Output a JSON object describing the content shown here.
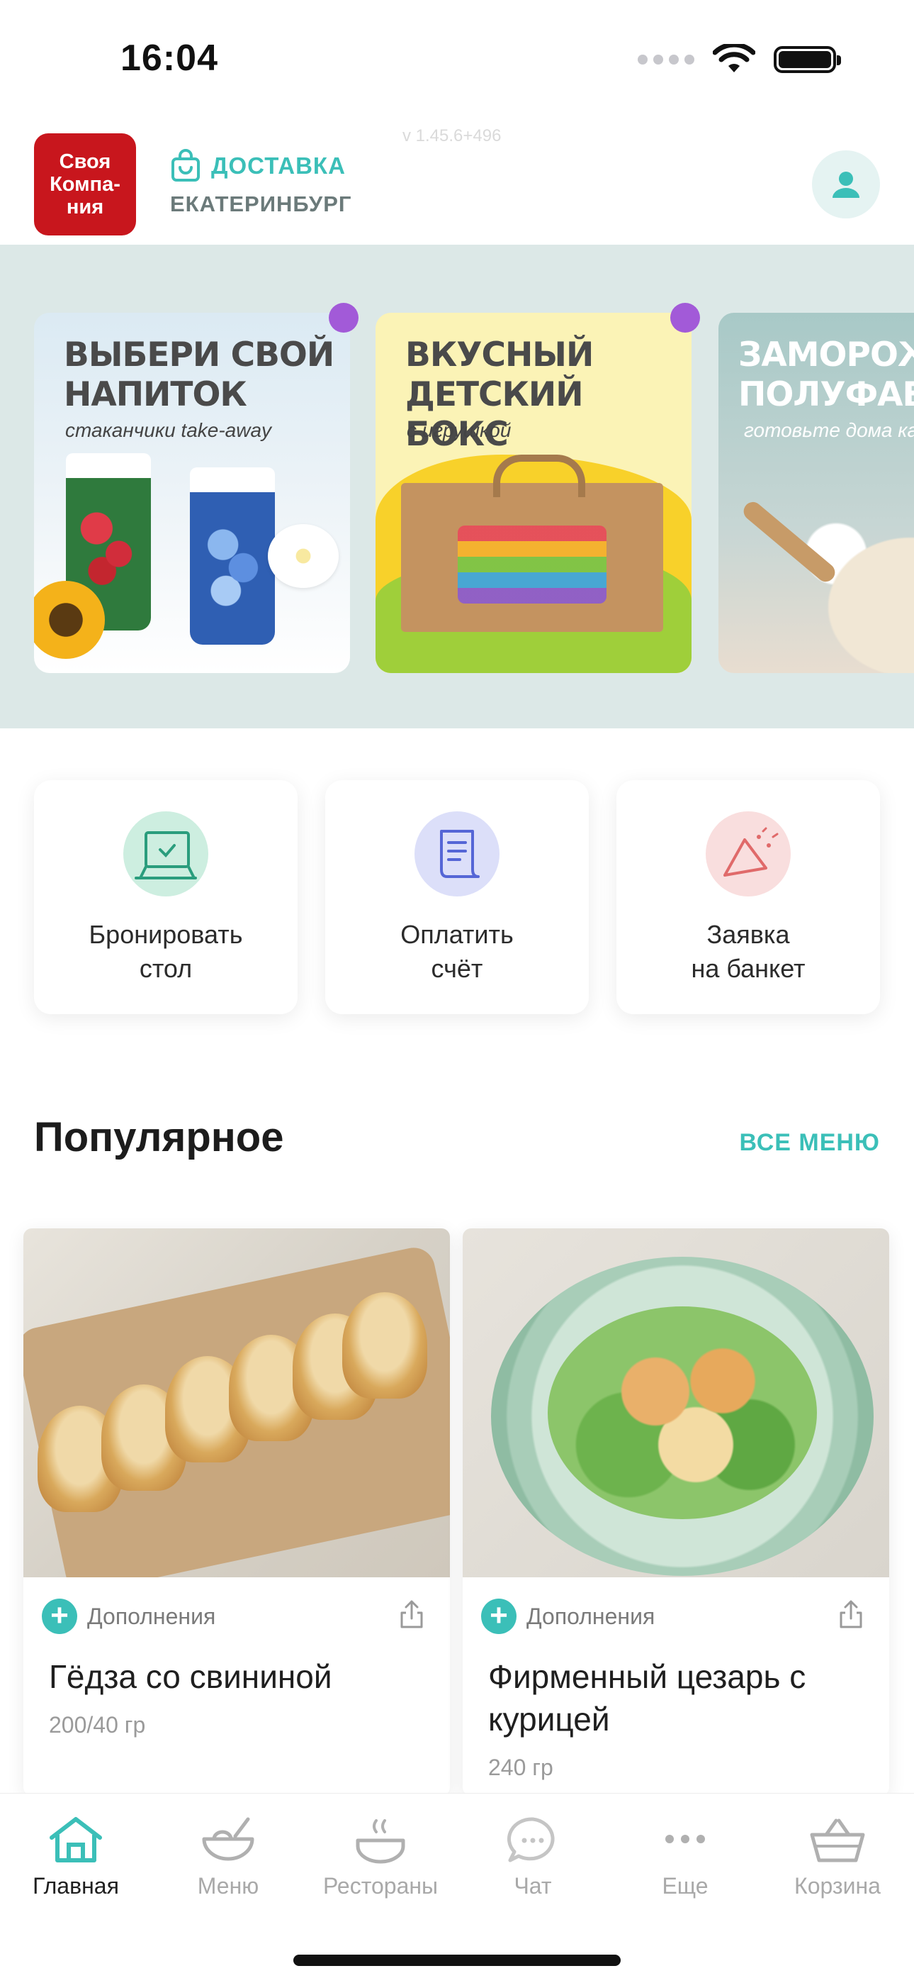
{
  "status": {
    "time": "16:04"
  },
  "header": {
    "logo_lines": [
      "Своя",
      "Компа-",
      "ния"
    ],
    "delivery_label": "ДОСТАВКА",
    "city": "ЕКАТЕРИНБУРГ",
    "version": "v 1.45.6+496"
  },
  "banners": [
    {
      "title": "ВЫБЕРИ СВОЙ\nНАПИТОК",
      "subtitle": "стаканчики take-away"
    },
    {
      "title": "ВКУСНЫЙ\nДЕТСКИЙ БОКС",
      "subtitle": "с игрушкой"
    },
    {
      "title": "ЗАМОРОЖЕ\nПОЛУФАБРИ",
      "subtitle": "готовьте дома как в"
    }
  ],
  "actions": [
    {
      "label": "Бронировать\nстол",
      "icon": "table-reserve-icon",
      "color": "#cdeee0"
    },
    {
      "label": "Оплатить\nсчёт",
      "icon": "receipt-icon",
      "color": "#dcdff9"
    },
    {
      "label": "Заявка\nна банкет",
      "icon": "party-icon",
      "color": "#f9dede"
    }
  ],
  "popular": {
    "title": "Популярное",
    "all_menu": "ВСЕ МЕНЮ",
    "items": [
      {
        "name": "Гёдза со свининой",
        "weight": "200/40 гр",
        "addons": "Дополнения"
      },
      {
        "name": "Фирменный цезарь с курицей",
        "weight": "240 гр",
        "addons": "Дополнения"
      }
    ]
  },
  "tabbar": {
    "tabs": [
      {
        "label": "Главная",
        "icon": "home-icon",
        "active": true
      },
      {
        "label": "Меню",
        "icon": "bowl-icon",
        "active": false
      },
      {
        "label": "Рестораны",
        "icon": "restaurant-icon",
        "active": false
      },
      {
        "label": "Чат",
        "icon": "chat-icon",
        "active": false
      },
      {
        "label": "Еще",
        "icon": "more-icon",
        "active": false
      },
      {
        "label": "Корзина",
        "icon": "basket-icon",
        "active": false
      }
    ]
  },
  "colors": {
    "accent": "#3bbfb8",
    "brand_red": "#c8161d",
    "badge_purple": "#a25ad8"
  }
}
